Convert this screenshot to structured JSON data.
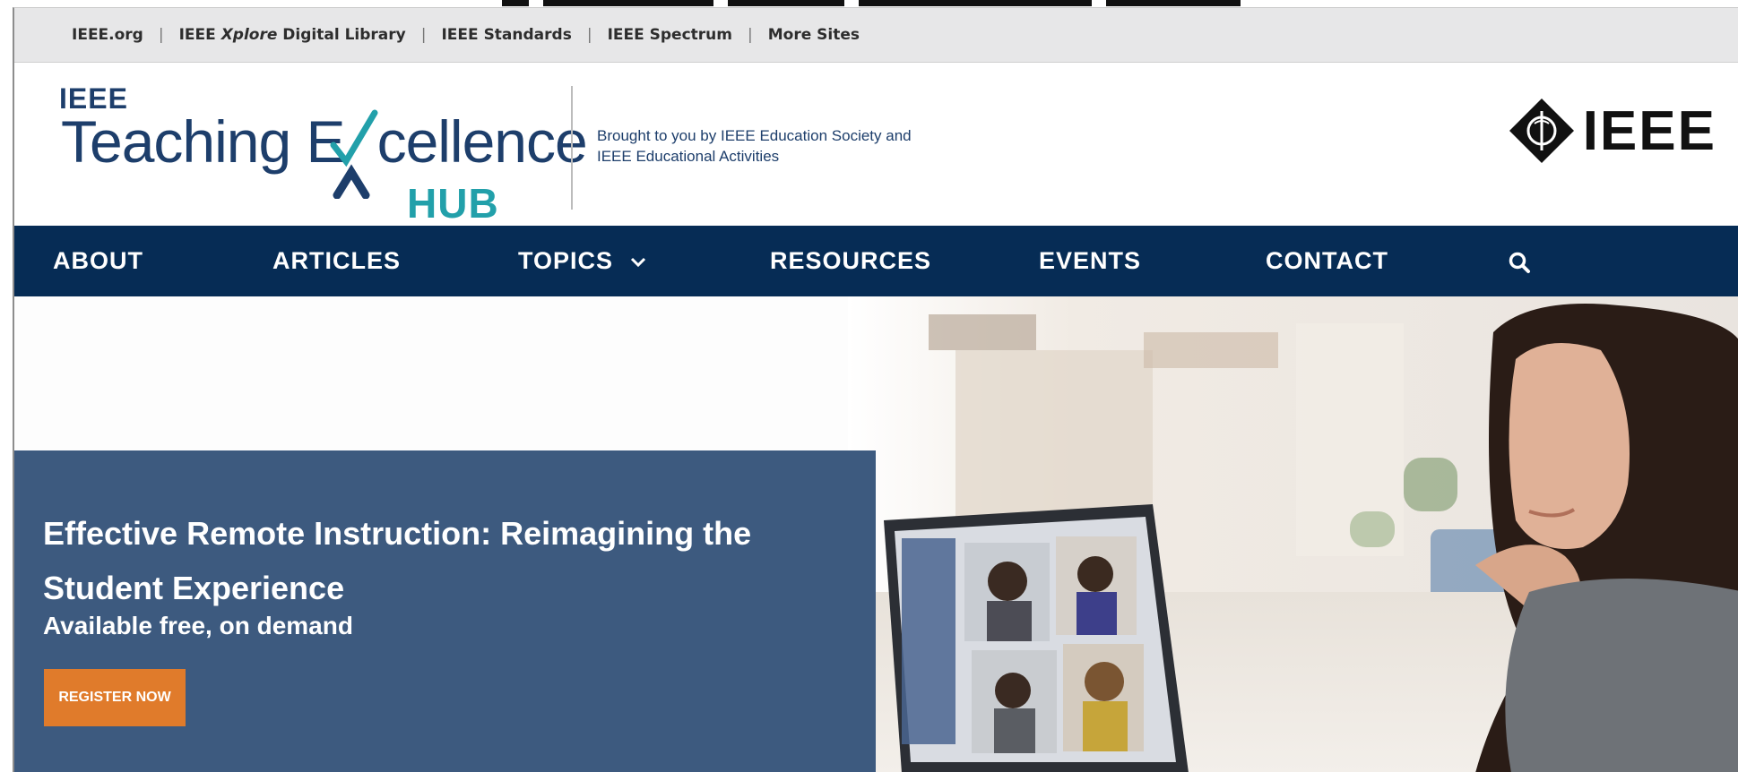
{
  "utility_links": [
    "IEEE.org",
    "IEEE Digital Library",
    "IEEE Standards",
    "IEEE Spectrum",
    "More Sites"
  ],
  "utility_xplore_prefix": "IEEE ",
  "utility_xplore_italic": "Xplore",
  "utility_xplore_suffix": " Digital Library",
  "logo": {
    "ieee": "IEEE",
    "teaching": "Teaching E",
    "excellence_rest": "cellence",
    "hub": "HUB"
  },
  "tagline": "Brought to you by IEEE Education Society and IEEE Educational Activities",
  "master_brand": "IEEE",
  "nav": {
    "about": "ABOUT",
    "articles": "ARTICLES",
    "topics": "TOPICS",
    "resources": "RESOURCES",
    "events": "EVENTS",
    "contact": "CONTACT"
  },
  "hero": {
    "title": "Effective Remote Instruction: Reimagining the Student Experience",
    "subtitle": "Available free, on demand",
    "cta": "REGISTER NOW"
  },
  "colors": {
    "nav_bg": "#062c55",
    "brand_blue": "#1d3e6b",
    "hub_teal": "#22a0aa",
    "hero_card": "#3d5a7f",
    "cta_orange": "#e07b2b"
  }
}
